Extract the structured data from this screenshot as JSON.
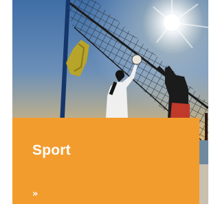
{
  "tile": {
    "title": "Sport",
    "link_glyph": "»",
    "accent_color": "#f39c2e"
  },
  "photo": {
    "subject_icon": "beach-volleyball-photo"
  }
}
